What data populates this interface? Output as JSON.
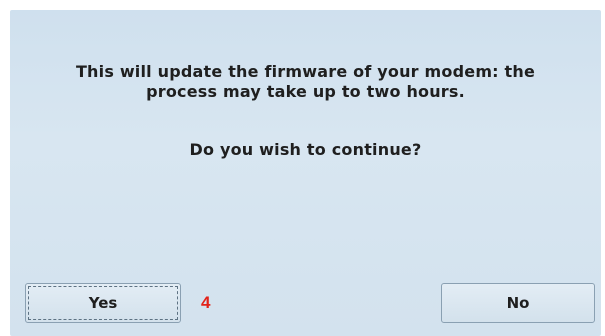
{
  "dialog": {
    "message_lines": [
      "This will update the firmware of your modem: the",
      "process may take up to two hours."
    ],
    "question": "Do you wish to continue?"
  },
  "buttons": {
    "yes_label": "Yes",
    "no_label": "No"
  },
  "annotation": {
    "label": "4",
    "color": "#e2231a"
  },
  "theme": {
    "background": "#d3e2ee",
    "text": "#1f1f1f"
  }
}
